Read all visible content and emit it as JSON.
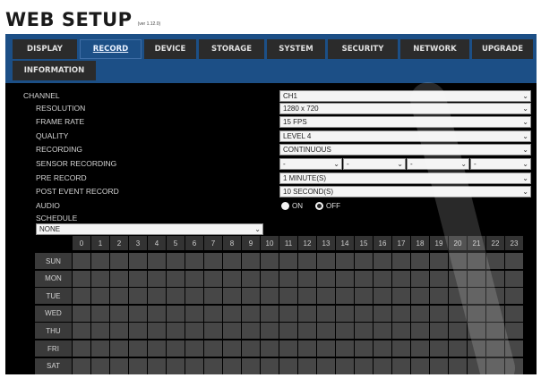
{
  "header": {
    "title": "WEB SETUP",
    "version": "(ver 1.12.0)"
  },
  "tabs_row1": [
    "DISPLAY",
    "RECORD",
    "DEVICE",
    "STORAGE",
    "SYSTEM",
    "SECURITY",
    "NETWORK",
    "UPGRADE"
  ],
  "tabs_row2": [
    "INFORMATION"
  ],
  "active_tab": "RECORD",
  "form": {
    "channel": {
      "label": "CHANNEL",
      "value": "CH1"
    },
    "resolution": {
      "label": "RESOLUTION",
      "value": "1280 x 720"
    },
    "frame_rate": {
      "label": "FRAME RATE",
      "value": "15 FPS"
    },
    "quality": {
      "label": "QUALITY",
      "value": "LEVEL 4"
    },
    "recording": {
      "label": "RECORDING",
      "value": "CONTINUOUS"
    },
    "sensor_recording": {
      "label": "SENSOR RECORDING",
      "values": [
        "-",
        "-",
        "-",
        "-"
      ]
    },
    "pre_record": {
      "label": "PRE RECORD",
      "value": "1 MINUTE(S)"
    },
    "post_event_record": {
      "label": "POST EVENT RECORD",
      "value": "10 SECOND(S)"
    },
    "audio": {
      "label": "AUDIO",
      "on_label": "ON",
      "off_label": "OFF",
      "selected": "OFF"
    },
    "schedule": {
      "label": "SCHEDULE",
      "value": "NONE"
    }
  },
  "schedule_grid": {
    "hours": [
      "0",
      "1",
      "2",
      "3",
      "4",
      "5",
      "6",
      "7",
      "8",
      "9",
      "10",
      "11",
      "12",
      "13",
      "14",
      "15",
      "16",
      "17",
      "18",
      "19",
      "20",
      "21",
      "22",
      "23"
    ],
    "days": [
      "SUN",
      "MON",
      "TUE",
      "WED",
      "THU",
      "FRI",
      "SAT"
    ]
  },
  "colors": {
    "accent": "#1c4f86",
    "panel": "#000000",
    "tab": "#2b2b2b",
    "cell": "#474747"
  },
  "icons": {
    "dropdown": "chevron-down-icon",
    "radio": "radio-icon"
  }
}
